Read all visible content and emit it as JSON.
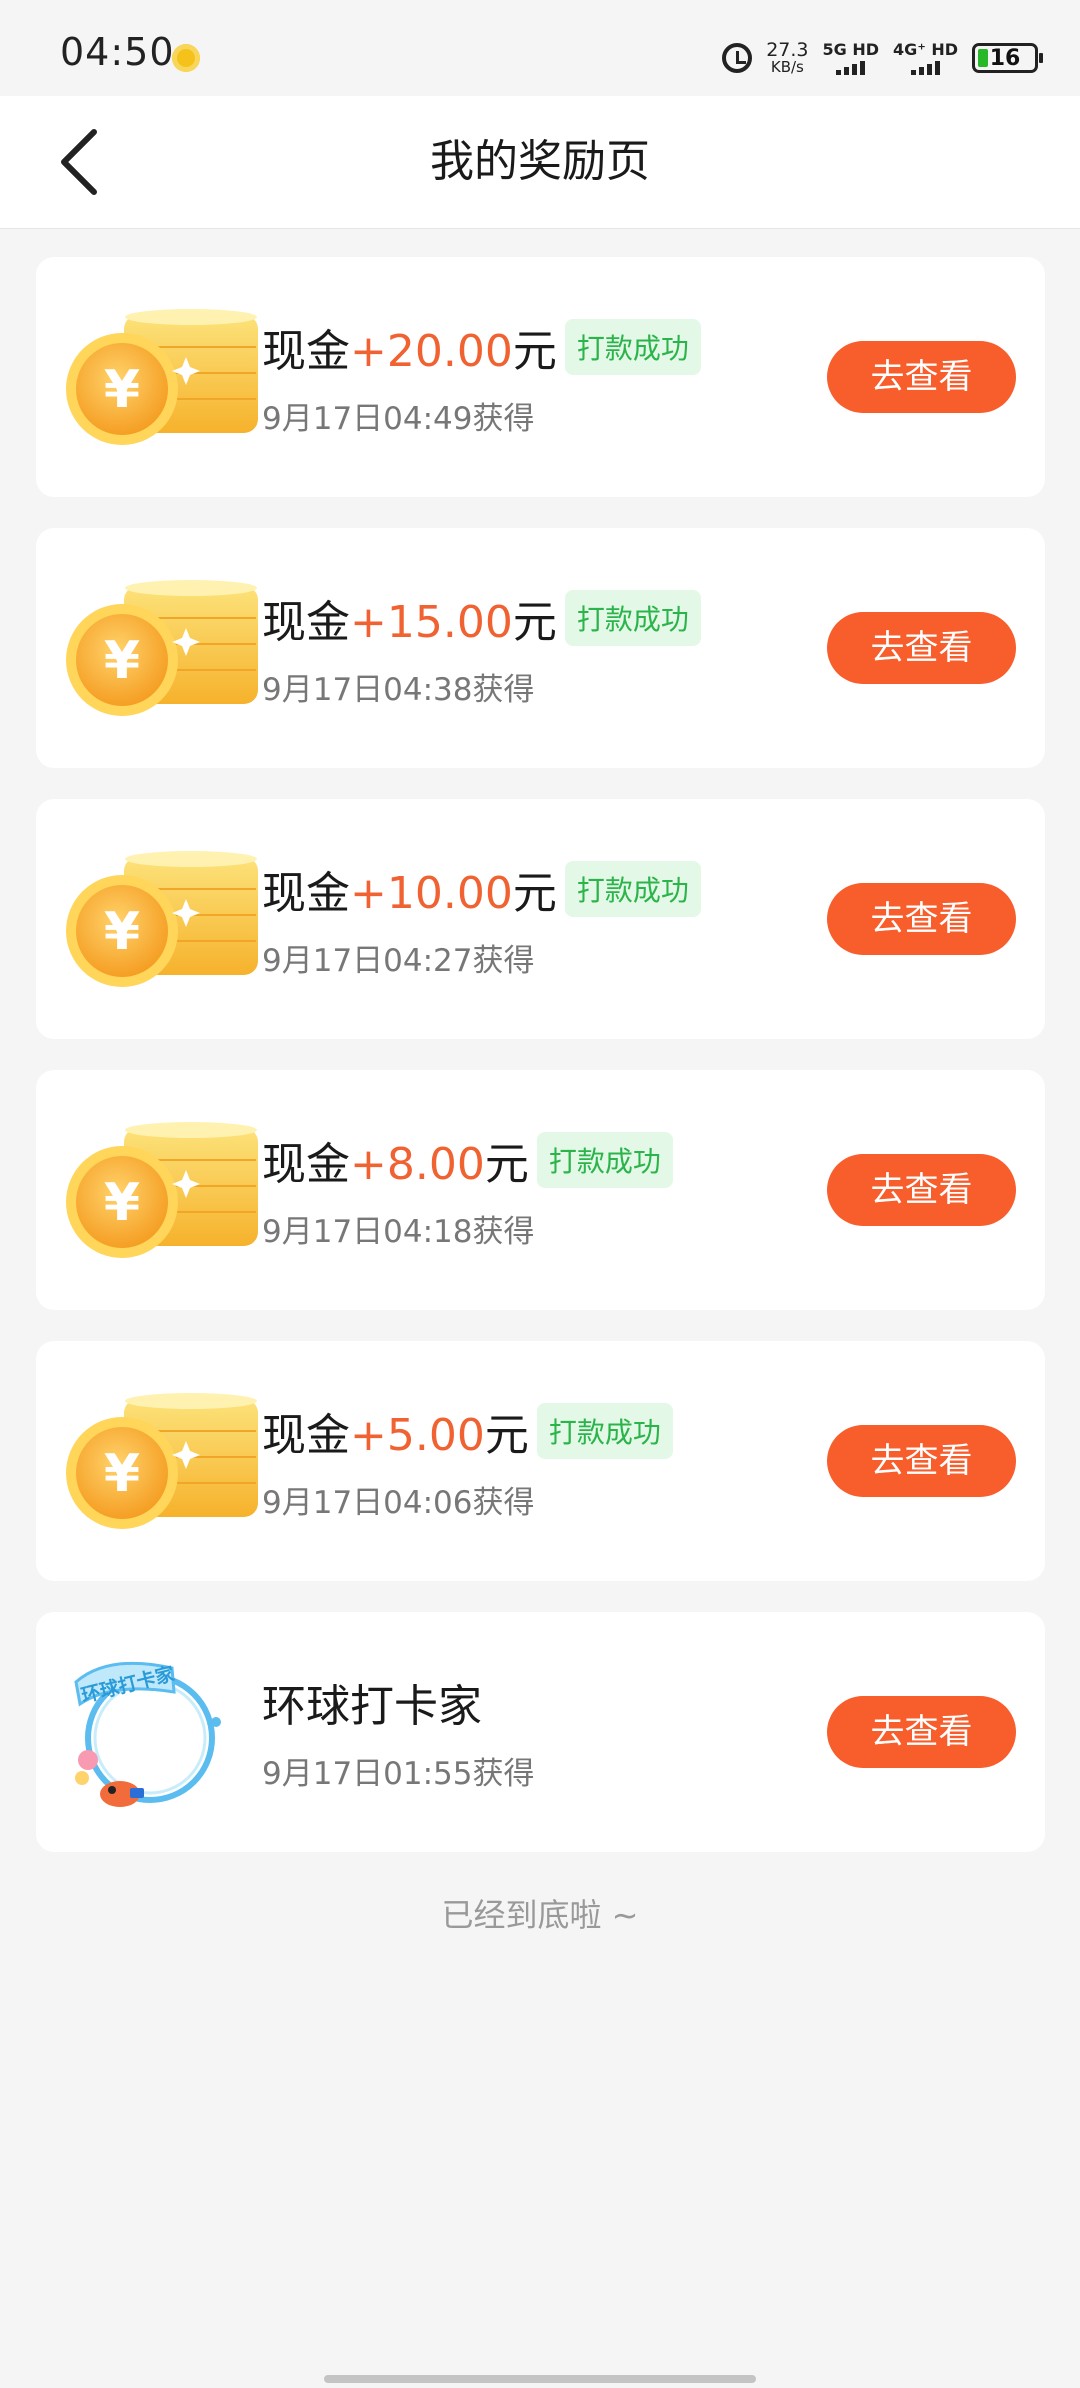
{
  "status_bar": {
    "time": "04:50",
    "speed_value": "27.3",
    "speed_unit": "KB/s",
    "network_1": "5G HD",
    "network_2": "4G⁺ HD",
    "battery": "16",
    "battery_color": "#26b826"
  },
  "header": {
    "title": "我的奖励页",
    "back_icon": "chevron-left-icon"
  },
  "rewards": [
    {
      "prefix": "现金",
      "amount": "+20.00",
      "suffix": "元",
      "status": "打款成功",
      "time": "9月17日04:49获得",
      "button": "去查看",
      "icon": "gold-coin-stack-icon"
    },
    {
      "prefix": "现金",
      "amount": "+15.00",
      "suffix": "元",
      "status": "打款成功",
      "time": "9月17日04:38获得",
      "button": "去查看",
      "icon": "gold-coin-stack-icon"
    },
    {
      "prefix": "现金",
      "amount": "+10.00",
      "suffix": "元",
      "status": "打款成功",
      "time": "9月17日04:27获得",
      "button": "去查看",
      "icon": "gold-coin-stack-icon"
    },
    {
      "prefix": "现金",
      "amount": "+8.00",
      "suffix": "元",
      "status": "打款成功",
      "time": "9月17日04:18获得",
      "button": "去查看",
      "icon": "gold-coin-stack-icon"
    },
    {
      "prefix": "现金",
      "amount": "+5.00",
      "suffix": "元",
      "status": "打款成功",
      "time": "9月17日04:06获得",
      "button": "去查看",
      "icon": "gold-coin-stack-icon"
    },
    {
      "title": "环球打卡家",
      "badge_text": "环球打卡家",
      "time": "9月17日01:55获得",
      "button": "去查看",
      "icon": "avatar-frame-badge-icon"
    }
  ],
  "footer": {
    "end_tip": "已经到底啦 ~"
  },
  "colors": {
    "accent": "#f85d2c",
    "amount": "#f06231",
    "success_text": "#2bb44a",
    "success_bg": "#e4f8e8",
    "background": "#f5f5f5"
  }
}
